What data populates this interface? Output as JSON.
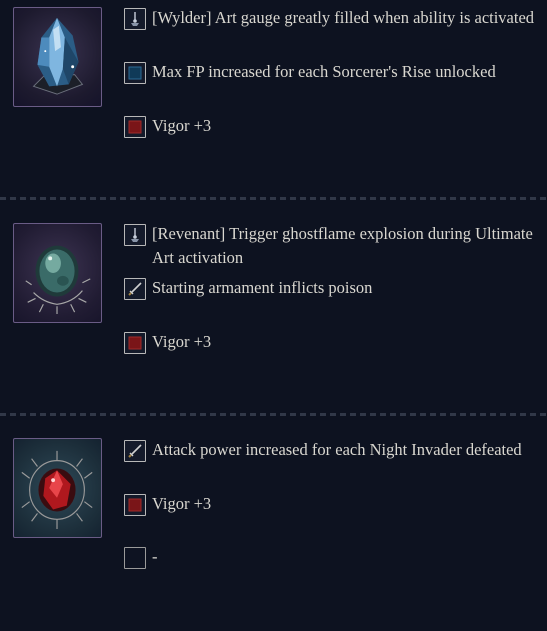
{
  "colors": {
    "background": "#0d1220",
    "frame_purple": "#6a5c86",
    "vigor_red": "#7a1518",
    "fp_blue": "#103a58",
    "text": "#d9d7d0"
  },
  "relics": [
    {
      "name_icon": "blue-crystal-relic-icon",
      "effects": [
        {
          "icon": "character-skill-icon",
          "text": "[Wylder] Art gauge greatly filled when ability is activated"
        },
        {
          "icon": "blue-square-icon",
          "text": "Max FP increased for each Sorcerer's Rise unlocked"
        },
        {
          "icon": "red-square-icon",
          "text": "Vigor +3"
        }
      ]
    },
    {
      "name_icon": "green-orb-relic-icon",
      "effects": [
        {
          "icon": "character-skill-icon",
          "text": "[Revenant] Trigger ghostflame explosion during Ultimate Art activation"
        },
        {
          "icon": "sword-icon",
          "text": "Starting armament inflicts poison"
        },
        {
          "icon": "red-square-icon",
          "text": "Vigor +3"
        }
      ]
    },
    {
      "name_icon": "red-gem-relic-icon",
      "effects": [
        {
          "icon": "sword-icon",
          "text": "Attack power increased for each Night Invader defeated"
        },
        {
          "icon": "red-square-icon",
          "text": "Vigor +3"
        },
        {
          "icon": "empty-slot-icon",
          "text": "-"
        }
      ]
    }
  ]
}
